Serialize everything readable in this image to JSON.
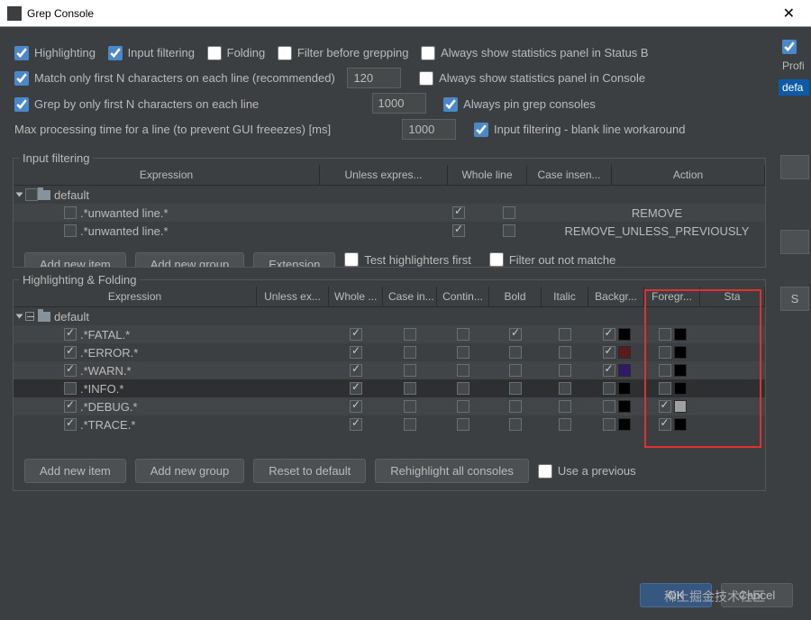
{
  "window": {
    "title": "Grep Console"
  },
  "options": {
    "highlighting_label": "Highlighting",
    "input_filtering_label": "Input filtering",
    "folding_label": "Folding",
    "filter_before_label": "Filter before grepping",
    "always_status_label": "Always show statistics panel in Status B",
    "match_first_n_label": "Match only first N characters on each line (recommended)",
    "match_first_n_value": "120",
    "always_console_label": "Always show statistics panel in Console",
    "grep_first_n_label": "Grep by only first N characters on each line",
    "grep_first_n_value": "1000",
    "always_pin_label": "Always pin grep consoles",
    "max_time_label": "Max processing time for a line (to prevent GUI freeezes) [ms]",
    "max_time_value": "1000",
    "blank_line_label": "Input filtering - blank line workaround"
  },
  "input_filtering": {
    "legend": "Input filtering",
    "headers": {
      "expr": "Expression",
      "unless": "Unless expres...",
      "whole": "Whole line",
      "case": "Case insen...",
      "action": "Action"
    },
    "group_label": "default",
    "rows": [
      {
        "expr": ".*unwanted line.*",
        "whole": true,
        "case": false,
        "action": "REMOVE"
      },
      {
        "expr": ".*unwanted line.*",
        "whole": true,
        "case": false,
        "action": "REMOVE_UNLESS_PREVIOUSLY"
      }
    ],
    "buttons": {
      "add_item": "Add new item",
      "add_group": "Add new group",
      "extension": "Extension",
      "test_first": "Test highlighters first",
      "filter_out": "Filter out not matche"
    }
  },
  "highlighting": {
    "legend": "Highlighting & Folding",
    "headers": {
      "expr": "Expression",
      "unless": "Unless ex...",
      "whole": "Whole ...",
      "case": "Case in...",
      "contin": "Contin...",
      "bold": "Bold",
      "italic": "Italic",
      "bg": "Backgr...",
      "fg": "Foregr...",
      "sta": "Sta"
    },
    "group_label": "default",
    "rows": [
      {
        "enabled": true,
        "expr": ".*FATAL.*",
        "whole": true,
        "case": false,
        "contin": false,
        "bold": true,
        "italic": false,
        "bg_on": true,
        "bg_color": "#000000",
        "fg_on": false,
        "fg_color": "#000000"
      },
      {
        "enabled": true,
        "expr": ".*ERROR.*",
        "whole": true,
        "case": false,
        "contin": false,
        "bold": false,
        "italic": false,
        "bg_on": true,
        "bg_color": "#5a1b1b",
        "fg_on": false,
        "fg_color": "#000000"
      },
      {
        "enabled": true,
        "expr": ".*WARN.*",
        "whole": true,
        "case": false,
        "contin": false,
        "bold": false,
        "italic": false,
        "bg_on": true,
        "bg_color": "#2e1a66",
        "fg_on": false,
        "fg_color": "#000000"
      },
      {
        "enabled": false,
        "expr": ".*INFO.*",
        "whole": true,
        "case": false,
        "contin": false,
        "bold": false,
        "italic": false,
        "bg_on": false,
        "bg_color": "#000000",
        "fg_on": false,
        "fg_color": "#000000",
        "selected": true
      },
      {
        "enabled": true,
        "expr": ".*DEBUG.*",
        "whole": true,
        "case": false,
        "contin": false,
        "bold": false,
        "italic": false,
        "bg_on": false,
        "bg_color": "#000000",
        "fg_on": true,
        "fg_color": "#a0a0a0"
      },
      {
        "enabled": true,
        "expr": ".*TRACE.*",
        "whole": true,
        "case": false,
        "contin": false,
        "bold": false,
        "italic": false,
        "bg_on": false,
        "bg_color": "#000000",
        "fg_on": true,
        "fg_color": "#000000"
      }
    ],
    "buttons": {
      "add_item": "Add new item",
      "add_group": "Add new group",
      "reset": "Reset to default",
      "rehighlight": "Rehighlight all consoles",
      "use_prev": "Use a previous"
    }
  },
  "side": {
    "profiles_label": "Profi",
    "default_label": "defa",
    "s_label": "S"
  },
  "footer": {
    "ok": "OK",
    "cancel": "Cancel",
    "watermark": "稀土掘金技术社区"
  }
}
